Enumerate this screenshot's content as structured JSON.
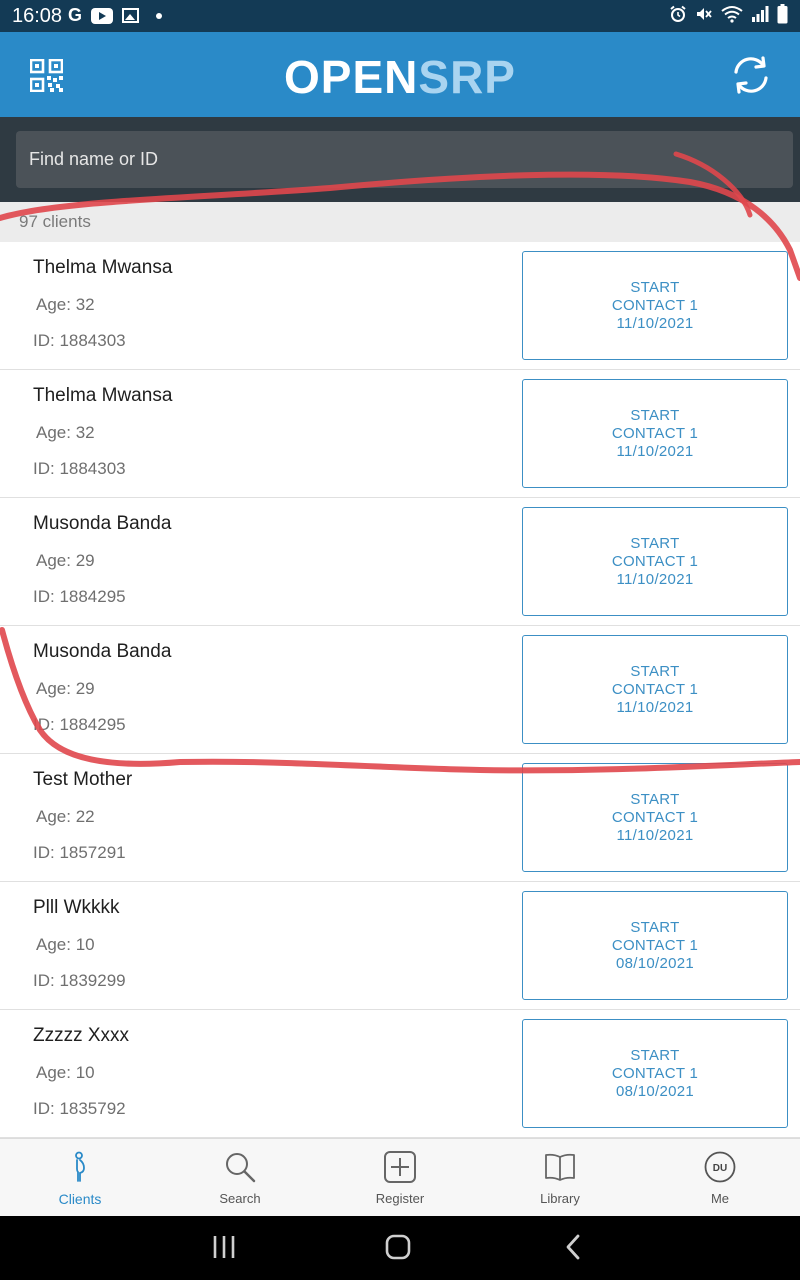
{
  "status_bar": {
    "time": "16:08",
    "g_label": "G"
  },
  "app_bar": {
    "title_part1": "OPEN",
    "title_part2": "SRP",
    "qr_icon": "qr-code-icon",
    "sync_icon": "sync-icon"
  },
  "search": {
    "placeholder": "Find name or ID",
    "value": ""
  },
  "count": {
    "label": "97 clients"
  },
  "clients": [
    {
      "name": "Thelma Mwansa",
      "age": "Age: 32",
      "id": "ID: 1884303",
      "btn": {
        "l1": "START",
        "l2": "CONTACT 1",
        "l3": "11/10/2021"
      }
    },
    {
      "name": "Thelma Mwansa",
      "age": "Age: 32",
      "id": "ID: 1884303",
      "btn": {
        "l1": "START",
        "l2": "CONTACT 1",
        "l3": "11/10/2021"
      }
    },
    {
      "name": "Musonda Banda",
      "age": "Age: 29",
      "id": "ID: 1884295",
      "btn": {
        "l1": "START",
        "l2": "CONTACT 1",
        "l3": "11/10/2021"
      }
    },
    {
      "name": "Musonda Banda",
      "age": "Age: 29",
      "id": "ID: 1884295",
      "btn": {
        "l1": "START",
        "l2": "CONTACT 1",
        "l3": "11/10/2021"
      }
    },
    {
      "name": "Test Mother",
      "age": "Age: 22",
      "id": "ID: 1857291",
      "btn": {
        "l1": "START",
        "l2": "CONTACT 1",
        "l3": "11/10/2021"
      }
    },
    {
      "name": "Plll Wkkkk",
      "age": "Age: 10",
      "id": "ID: 1839299",
      "btn": {
        "l1": "START",
        "l2": "CONTACT 1",
        "l3": "08/10/2021"
      }
    },
    {
      "name": "Zzzzz Xxxx",
      "age": "Age: 10",
      "id": "ID: 1835792",
      "btn": {
        "l1": "START",
        "l2": "CONTACT 1",
        "l3": "08/10/2021"
      }
    }
  ],
  "bottom_nav": {
    "items": [
      {
        "label": "Clients",
        "icon": "pregnant-woman-icon",
        "active": true
      },
      {
        "label": "Search",
        "icon": "search-icon",
        "active": false
      },
      {
        "label": "Register",
        "icon": "plus-box-icon",
        "active": false
      },
      {
        "label": "Library",
        "icon": "book-icon",
        "active": false
      },
      {
        "label": "Me",
        "icon": "avatar-icon",
        "active": false,
        "avatar_initials": "DU"
      }
    ]
  },
  "colors": {
    "primary": "#2a8ac8",
    "accent_text": "#3c8fc4",
    "status_bar": "#133a55",
    "search_bg": "#2f3a42",
    "annotation": "#e0474c"
  }
}
